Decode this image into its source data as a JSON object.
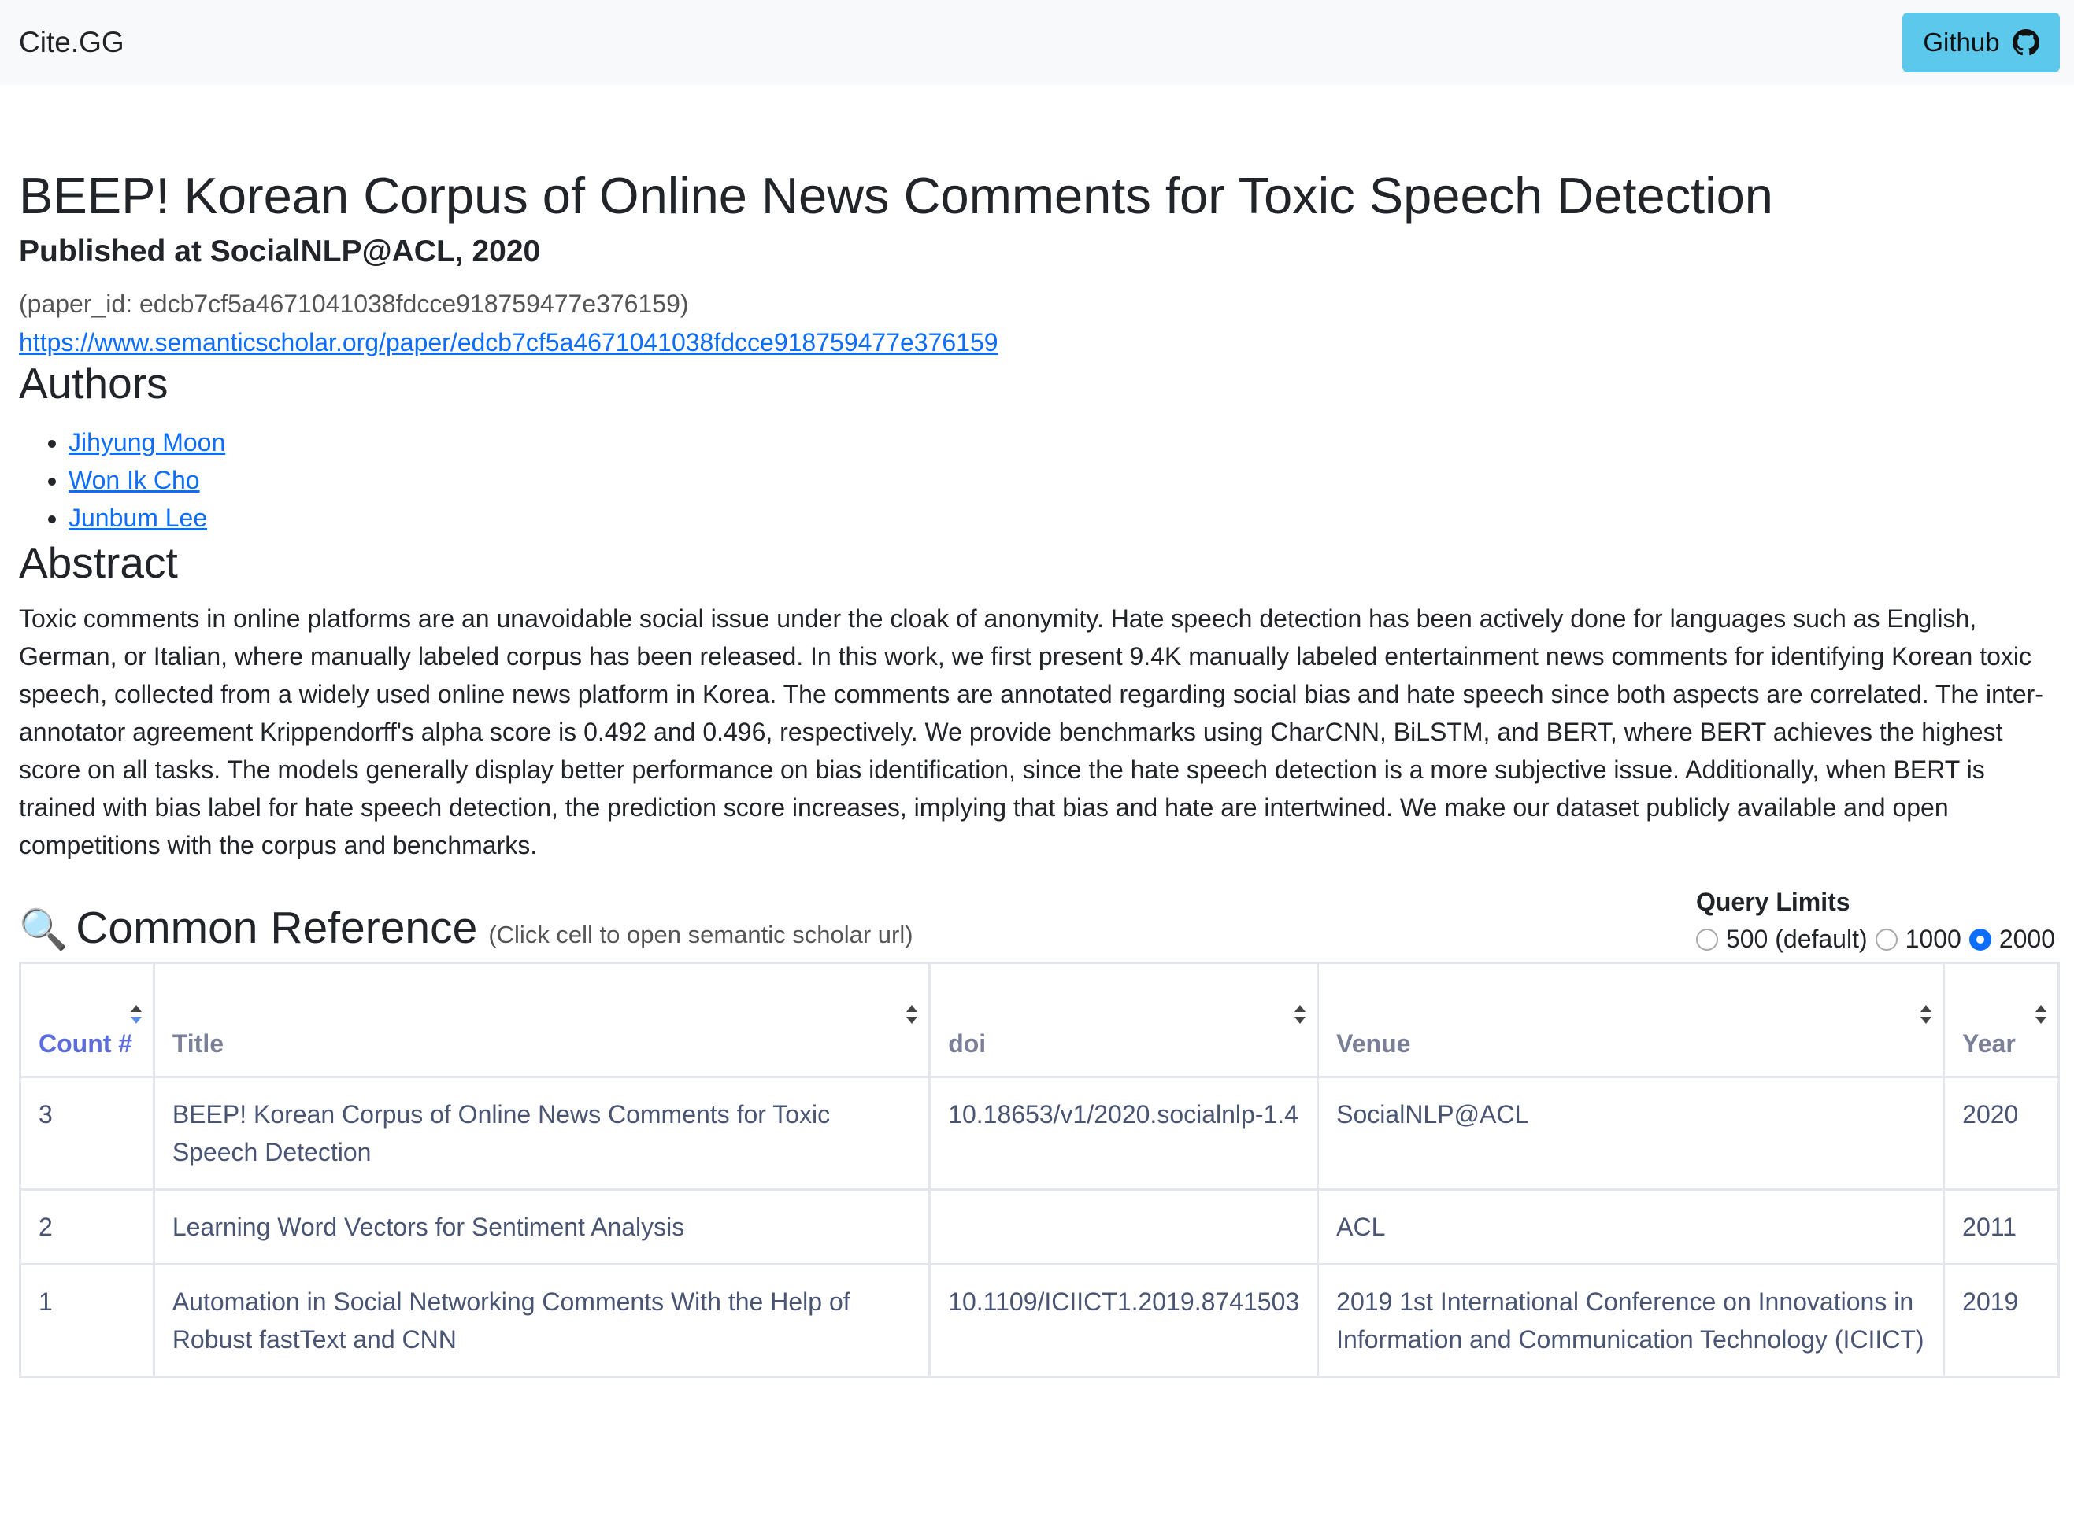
{
  "navbar": {
    "brand": "Cite.GG",
    "github_label": "Github"
  },
  "paper": {
    "title": "BEEP! Korean Corpus of Online News Comments for Toxic Speech Detection",
    "published": "Published at SocialNLP@ACL, 2020",
    "paper_id_text": "(paper_id: edcb7cf5a4671041038fdcce918759477e376159)",
    "url": "https://www.semanticscholar.org/paper/edcb7cf5a4671041038fdcce918759477e376159"
  },
  "authors": {
    "heading": "Authors",
    "list": [
      "Jihyung Moon",
      "Won Ik Cho",
      "Junbum Lee"
    ]
  },
  "abstract": {
    "heading": "Abstract",
    "text": "Toxic comments in online platforms are an unavoidable social issue under the cloak of anonymity. Hate speech detection has been actively done for languages such as English, German, or Italian, where manually labeled corpus has been released. In this work, we first present 9.4K manually labeled entertainment news comments for identifying Korean toxic speech, collected from a widely used online news platform in Korea. The comments are annotated regarding social bias and hate speech since both aspects are correlated. The inter-annotator agreement Krippendorff's alpha score is 0.492 and 0.496, respectively. We provide benchmarks using CharCNN, BiLSTM, and BERT, where BERT achieves the highest score on all tasks. The models generally display better performance on bias identification, since the hate speech detection is a more subjective issue. Additionally, when BERT is trained with bias label for hate speech detection, the prediction score increases, implying that bias and hate are intertwined. We make our dataset publicly available and open competitions with the corpus and benchmarks."
  },
  "common_reference": {
    "icon": "magnifier-icon",
    "heading": "Common Reference",
    "hint": "(Click cell to open semantic scholar url)",
    "query_limits": {
      "label": "Query Limits",
      "options": [
        "500 (default)",
        "1000",
        "2000"
      ],
      "selected": "2000"
    },
    "columns": [
      "Count #",
      "Title",
      "doi",
      "Venue",
      "Year"
    ],
    "rows": [
      {
        "count": "3",
        "title": "BEEP! Korean Corpus of Online News Comments for Toxic Speech Detection",
        "doi": "10.18653/v1/2020.socialnlp-1.4",
        "venue": "SocialNLP@ACL",
        "year": "2020"
      },
      {
        "count": "2",
        "title": "Learning Word Vectors for Sentiment Analysis",
        "doi": "",
        "venue": "ACL",
        "year": "2011"
      },
      {
        "count": "1",
        "title": "Automation in Social Networking Comments With the Help of Robust fastText and CNN",
        "doi": "10.1109/ICIICT1.2019.8741503",
        "venue": "2019 1st International Conference on Innovations in Information and Communication Technology (ICIICT)",
        "year": "2019"
      }
    ]
  },
  "colors": {
    "navbar_bg": "#f8f9fa",
    "github_btn": "#5bc8ec",
    "link": "#0d6efd",
    "table_text": "#4a5573",
    "active_header": "#5d6ddb"
  }
}
